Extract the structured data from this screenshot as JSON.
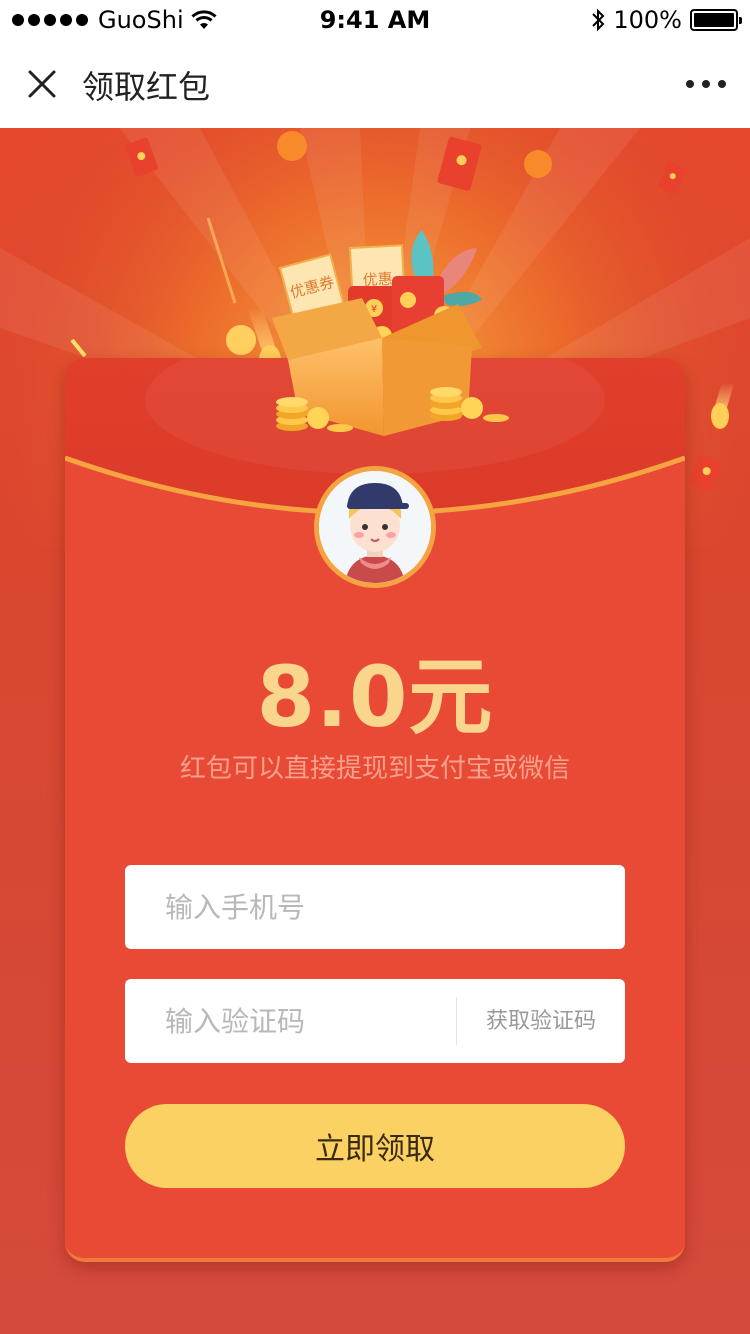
{
  "statusbar": {
    "carrier": "GuoShi",
    "time": "9:41 AM",
    "battery": "100%"
  },
  "navbar": {
    "title": "领取红包"
  },
  "redpacket": {
    "amount": "8.0元",
    "subtitle": "红包可以直接提现到支付宝或微信",
    "ticket_label": "优惠券",
    "ticket_label_short": "优惠",
    "coin_symbol": "¥"
  },
  "form": {
    "phone_placeholder": "输入手机号",
    "code_placeholder": "输入验证码",
    "get_code_label": "获取验证码",
    "submit_label": "立即领取"
  },
  "colors": {
    "background": "#d84a37",
    "card": "#e84a35",
    "amount": "#fad58c",
    "button": "#fcd164",
    "accent_orange": "#f6a341"
  }
}
